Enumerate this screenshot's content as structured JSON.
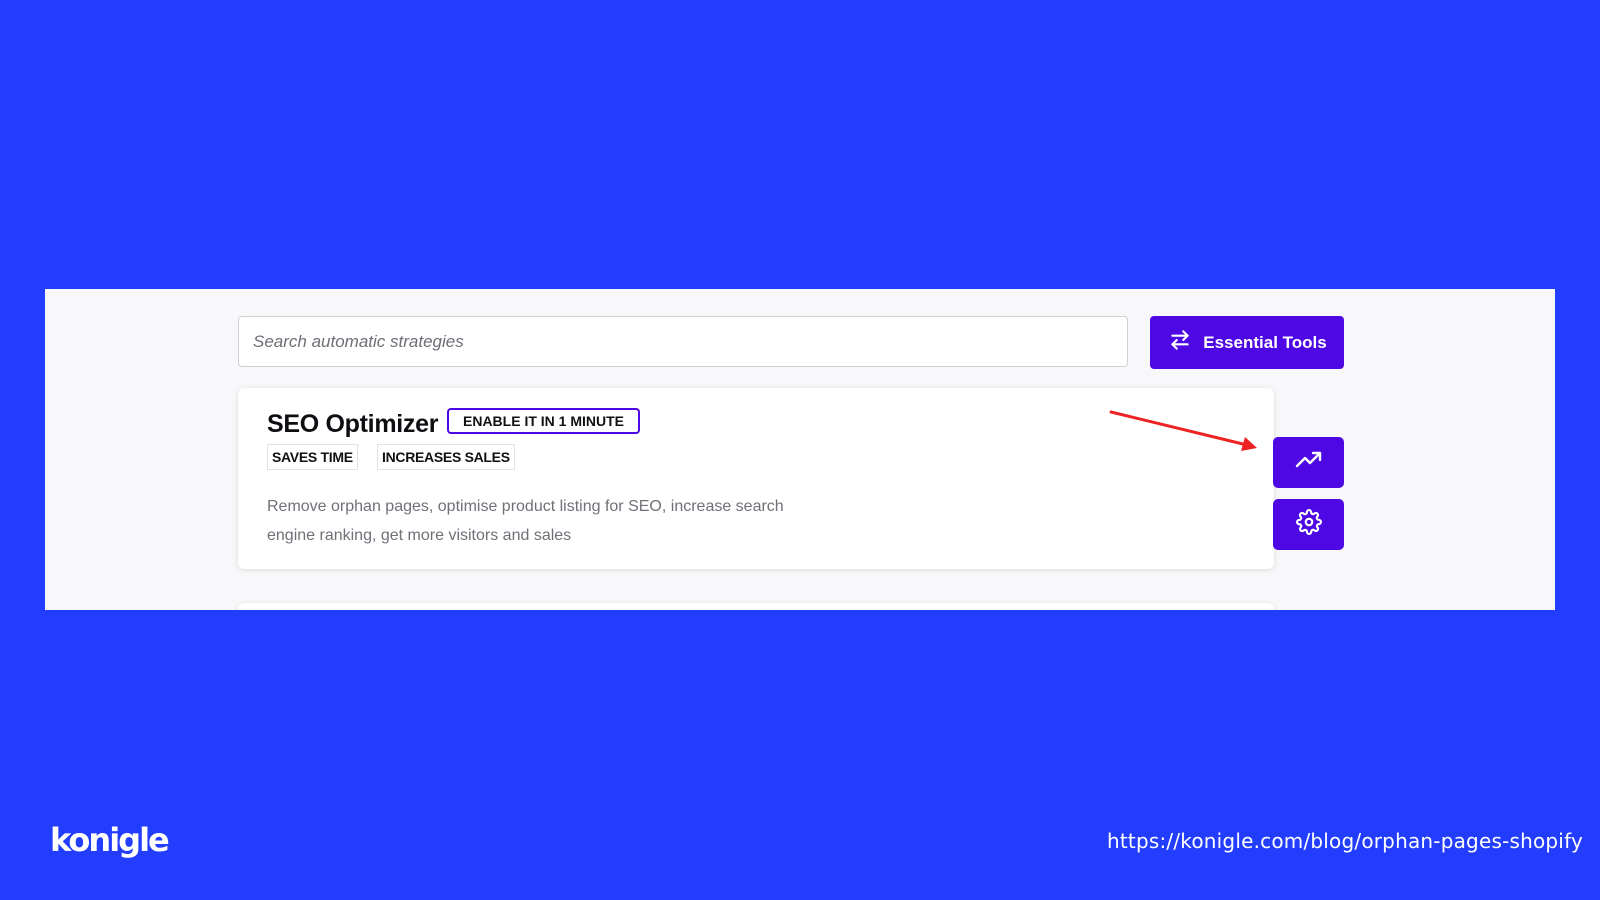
{
  "search": {
    "placeholder": "Search automatic strategies",
    "value": ""
  },
  "toolbar": {
    "essential_tools_label": "Essential Tools",
    "essential_tools_icon": "swap-arrows-icon"
  },
  "strategy_card": {
    "title": "SEO Optimizer",
    "badge": "ENABLE IT IN 1 MINUTE",
    "tags": [
      "SAVES TIME",
      "INCREASES SALES"
    ],
    "description": "Remove orphan pages, optimise product listing for SEO, increase search engine ranking, get more visitors and sales"
  },
  "side_actions": {
    "trend_icon": "trending-up-icon",
    "settings_icon": "gear-icon"
  },
  "footer": {
    "logo": "konigle",
    "url": "https://konigle.com/blog/orphan-pages-shopify"
  },
  "colors": {
    "background": "#233dff",
    "accent": "#4d08e3",
    "annotation_arrow": "#ee2222"
  }
}
